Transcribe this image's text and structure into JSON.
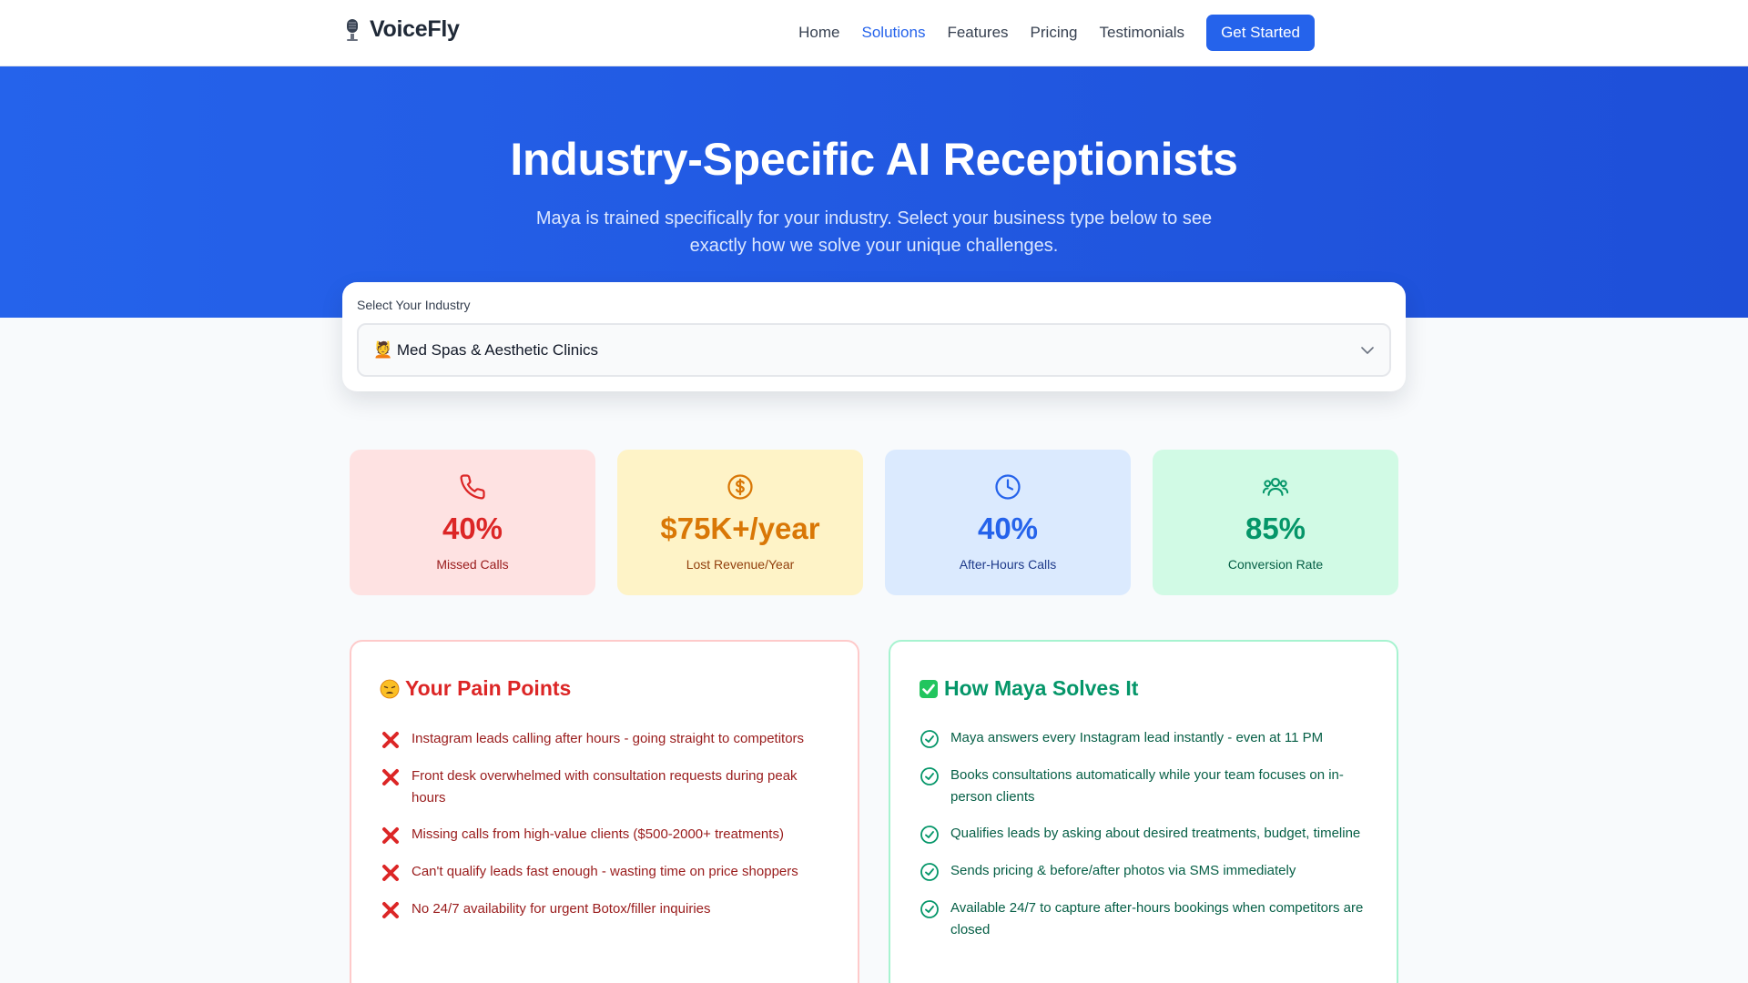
{
  "nav": {
    "brand": "VoiceFly",
    "links": [
      "Home",
      "Solutions",
      "Features",
      "Pricing",
      "Testimonials"
    ],
    "active": "Solutions",
    "cta": "Get Started"
  },
  "hero": {
    "title": "Industry-Specific AI Receptionists",
    "subtitle": "Maya is trained specifically for your industry. Select your business type below to see exactly how we solve your unique challenges."
  },
  "selector": {
    "label": "Select Your Industry",
    "value": "💆 Med Spas & Aesthetic Clinics"
  },
  "stats": [
    {
      "icon": "phone-icon",
      "value": "40%",
      "label": "Missed Calls",
      "color": "#dc2626"
    },
    {
      "icon": "dollar-icon",
      "value": "$75K+/year",
      "label": "Lost Revenue/Year",
      "color": "#d97706"
    },
    {
      "icon": "clock-icon",
      "value": "40%",
      "label": "After-Hours Calls",
      "color": "#2563eb"
    },
    {
      "icon": "users-icon",
      "value": "85%",
      "label": "Conversion Rate",
      "color": "#059669"
    }
  ],
  "pain": {
    "title": "Your Pain Points",
    "icon": "weary-face-icon",
    "items": [
      "Instagram leads calling after hours - going straight to competitors",
      "Front desk overwhelmed with consultation requests during peak hours",
      "Missing calls from high-value clients ($500-2000+ treatments)",
      "Can't qualify leads fast enough - wasting time on price shoppers",
      "No 24/7 availability for urgent Botox/filler inquiries"
    ]
  },
  "solve": {
    "title": "How Maya Solves It",
    "icon": "check-mark-button-icon",
    "items": [
      "Maya answers every Instagram lead instantly - even at 11 PM",
      "Books consultations automatically while your team focuses on in-person clients",
      "Qualifies leads by asking about desired treatments, budget, timeline",
      "Sends pricing & before/after photos via SMS immediately",
      "Available 24/7 to capture after-hours bookings when competitors are closed"
    ]
  }
}
